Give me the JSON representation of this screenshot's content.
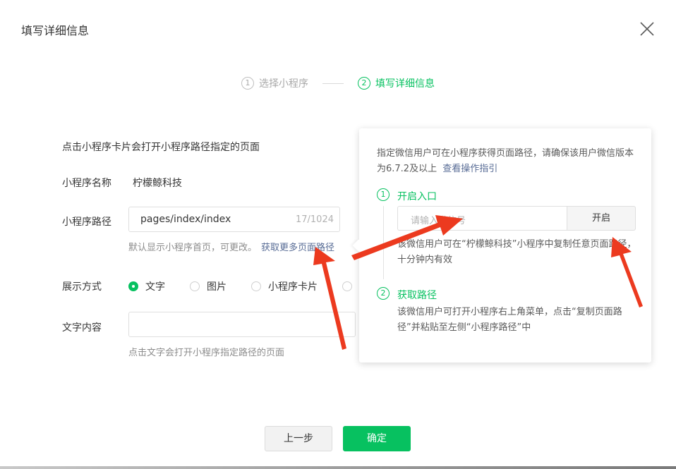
{
  "dialog": {
    "title": "填写详细信息"
  },
  "steps": [
    {
      "num": "1",
      "label": "选择小程序"
    },
    {
      "num": "2",
      "label": "填写详细信息"
    }
  ],
  "form": {
    "description": "点击小程序卡片会打开小程序路径指定的页面",
    "name_label": "小程序名称",
    "name_value": "柠檬鲸科技",
    "path_label": "小程序路径",
    "path_value": "pages/index/index",
    "path_counter": "17/1024",
    "path_hint": "默认显示小程序首页，可更改。",
    "path_link": "获取更多页面路径",
    "display_label": "展示方式",
    "display_options": [
      "文字",
      "图片",
      "小程序卡片"
    ],
    "display_selected": "文字",
    "content_label": "文字内容",
    "content_value": "",
    "content_hint": "点击文字会打开小程序指定路径的页面"
  },
  "popover": {
    "intro": "指定微信用户可在小程序获得页面路径，请确保该用户微信版本为6.7.2及以上",
    "intro_link": "查看操作指引",
    "step1_num": "1",
    "step1_title": "开启入口",
    "wechat_placeholder": "请输入微信号",
    "open_button": "开启",
    "step1_desc": "该微信用户可在“柠檬鲸科技”小程序中复制任意页面路径，十分钟内有效",
    "step2_num": "2",
    "step2_title": "获取路径",
    "step2_desc": "该微信用户可打开小程序右上角菜单，点击“复制页面路径”并粘贴至左侧“小程序路径”中"
  },
  "buttons": {
    "prev": "上一步",
    "confirm": "确定"
  },
  "colors": {
    "accent": "#07c160",
    "link": "#576b95",
    "annotation_arrow": "#ec3a1f"
  }
}
